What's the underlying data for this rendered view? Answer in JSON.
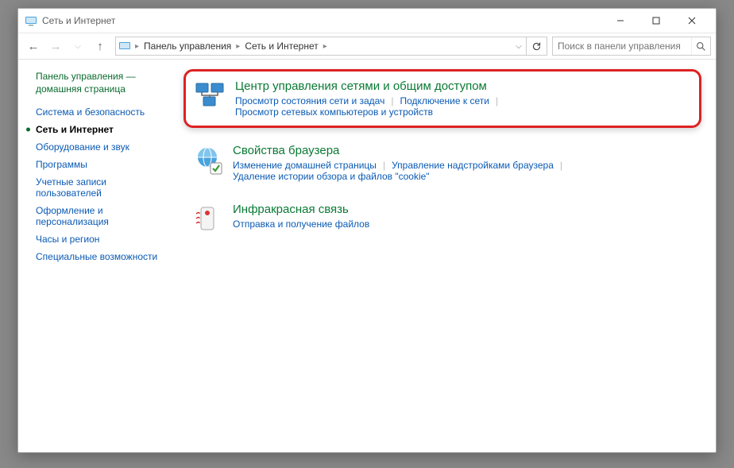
{
  "window": {
    "title": "Сеть и Интернет"
  },
  "breadcrumb": {
    "root": "Панель управления",
    "current": "Сеть и Интернет"
  },
  "search": {
    "placeholder": "Поиск в панели управления"
  },
  "sidebar": {
    "home1": "Панель управления —",
    "home2": "домашняя страница",
    "items": [
      "Система и безопасность",
      "Сеть и Интернет",
      "Оборудование и звук",
      "Программы",
      "Учетные записи пользователей",
      "Оформление и персонализация",
      "Часы и регион",
      "Специальные возможности"
    ],
    "current_index": 1
  },
  "categories": [
    {
      "title": "Центр управления сетями и общим доступом",
      "links": [
        "Просмотр состояния сети и задач",
        "Подключение к сети",
        "Просмотр сетевых компьютеров и устройств"
      ],
      "highlighted": true
    },
    {
      "title": "Свойства браузера",
      "links": [
        "Изменение домашней страницы",
        "Управление надстройками браузера",
        "Удаление истории обзора и файлов \"cookie\""
      ],
      "highlighted": false
    },
    {
      "title": "Инфракрасная связь",
      "links": [
        "Отправка и получение файлов"
      ],
      "highlighted": false
    }
  ]
}
